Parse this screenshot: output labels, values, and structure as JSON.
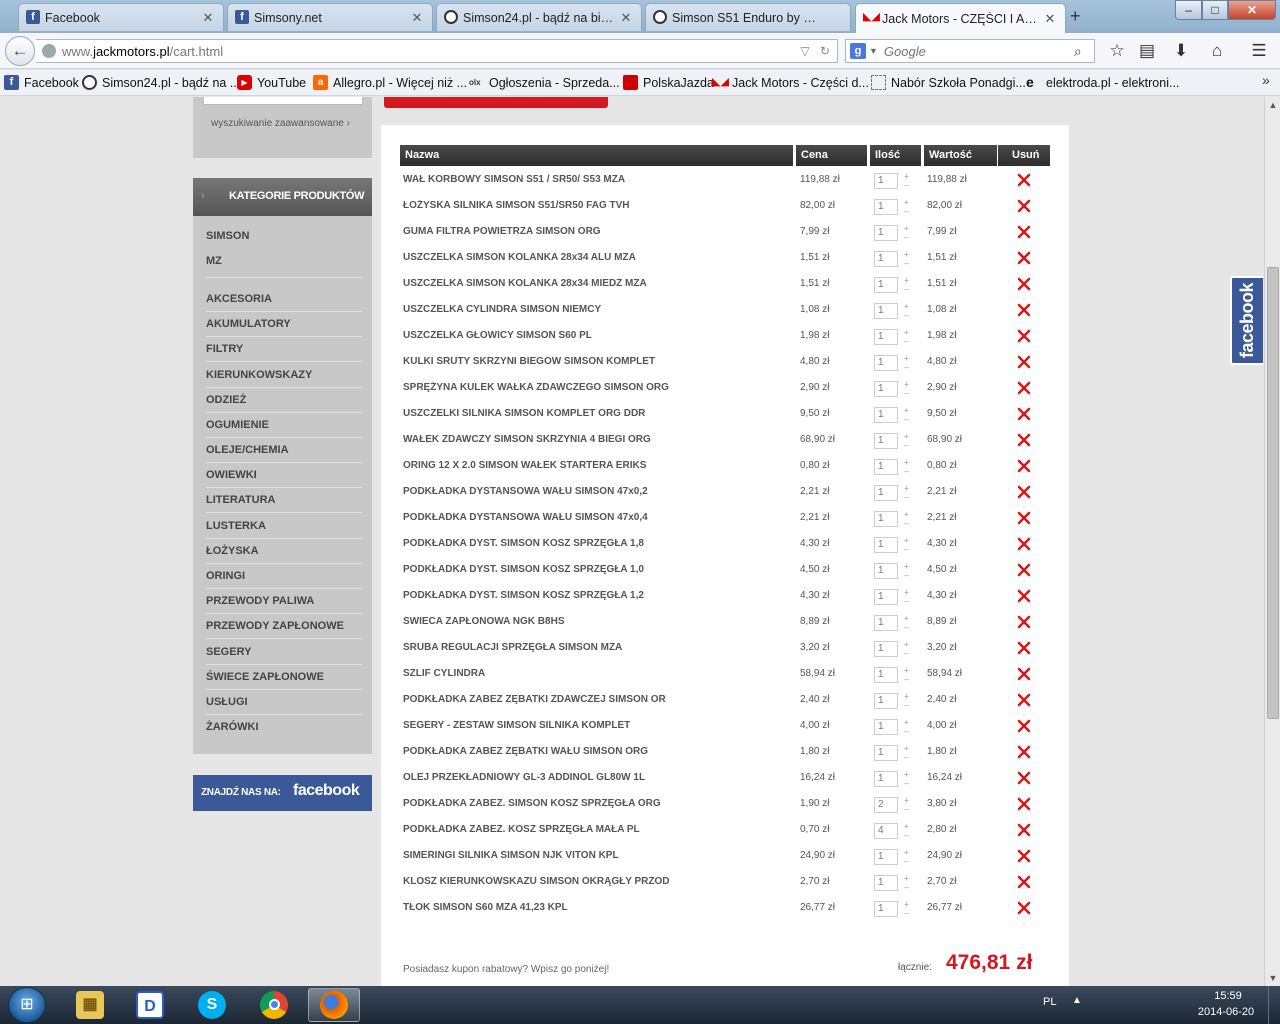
{
  "tabs": [
    {
      "label": "Facebook",
      "icon": "facebook-icon",
      "close": "✕"
    },
    {
      "label": "Simsony.net",
      "icon": "facebook-icon",
      "close": "✕"
    },
    {
      "label": "Simson24.pl - bądź na bież...",
      "icon": "clock-icon",
      "close": "✕"
    },
    {
      "label": "Simson S51 Enduro by Dan...",
      "icon": "clock-icon",
      "close": ""
    },
    {
      "label": "Jack Motors - CZĘŚCI I AK...",
      "icon": "motorbike-icon",
      "close": "✕"
    }
  ],
  "newtab_label": "+",
  "window": {
    "minimize": "–",
    "maximize": "□",
    "close": "✕"
  },
  "address": {
    "prefix": "www.",
    "domain": "jackmotors.pl",
    "path": "/cart.html"
  },
  "search": {
    "placeholder": "Google",
    "engine_icon": "google-icon"
  },
  "bookmarks": [
    {
      "label": "Facebook",
      "icon": "facebook-icon"
    },
    {
      "label": "Simson24.pl - bądź na ...",
      "icon": "clock-icon"
    },
    {
      "label": "YouTube",
      "icon": "youtube-icon"
    },
    {
      "label": "Allegro.pl - Więcej niż ...",
      "icon": "allegro-icon"
    },
    {
      "label": "Ogłoszenia - Sprzeda...",
      "icon": "olx-icon"
    },
    {
      "label": "PolskaJazda",
      "icon": "polskajazda-icon"
    },
    {
      "label": "Jack Motors - Części d...",
      "icon": "motorbike-icon"
    },
    {
      "label": "Nabór Szkoła Ponadgi...",
      "icon": "page-icon"
    },
    {
      "label": "elektroda.pl - elektroni...",
      "icon": "elektroda-icon"
    }
  ],
  "bookmarks_more": "»",
  "sidebar": {
    "adv_search": "wyszukiwanie zaawansowane ›",
    "cat_title": "KATEGORIE PRODUKTÓW",
    "categories": [
      "SIMSON",
      "MZ",
      "AKCESORIA",
      "AKUMULATORY",
      "FILTRY",
      "KIERUNKOWSKAZY",
      "ODZIEŻ",
      "OGUMIENIE",
      "OLEJE/CHEMIA",
      "OWIEWKI",
      "LITERATURA",
      "LUSTERKA",
      "ŁOŻYSKA",
      "ORINGI",
      "PRZEWODY PALIWA",
      "PRZEWODY ZAPŁONOWE",
      "SEGERY",
      "ŚWIECE ZAPŁONOWE",
      "USŁUGI",
      "ŻARÓWKI"
    ],
    "fb_find": "ZNAJDŹ NAS NA:",
    "fb_logo": "facebook"
  },
  "cart": {
    "headers": {
      "name": "Nazwa",
      "price": "Cena",
      "qty": "Ilość",
      "value": "Wartość",
      "remove": "Usuń"
    },
    "spinner": {
      "up": "+",
      "down": "–"
    },
    "items": [
      {
        "name": "WAŁ KORBOWY SIMSON S51 / SR50/ S53 MZA",
        "price": "119,88 zł",
        "qty": "1",
        "value": "119,88 zł"
      },
      {
        "name": "ŁOŻYSKA SILNIKA SIMSON S51/SR50 FAG TVH",
        "price": "82,00 zł",
        "qty": "1",
        "value": "82,00 zł"
      },
      {
        "name": "GUMA FILTRA POWIETRZA SIMSON ORG",
        "price": "7,99 zł",
        "qty": "1",
        "value": "7,99 zł"
      },
      {
        "name": "USZCZELKA SIMSON KOLANKA 28x34 ALU MZA",
        "price": "1,51 zł",
        "qty": "1",
        "value": "1,51 zł"
      },
      {
        "name": "USZCZELKA SIMSON KOLANKA 28x34 MIEDŹ MZA",
        "price": "1,51 zł",
        "qty": "1",
        "value": "1,51 zł"
      },
      {
        "name": "USZCZELKA CYLINDRA SIMSON NIEMCY",
        "price": "1,08 zł",
        "qty": "1",
        "value": "1,08 zł"
      },
      {
        "name": "USZCZELKA GŁOWICY SIMSON S60 PL",
        "price": "1,98 zł",
        "qty": "1",
        "value": "1,98 zł"
      },
      {
        "name": "KULKI ŚRUTY SKRZYNI BIEGÓW SIMSON KOMPLET",
        "price": "4,80 zł",
        "qty": "1",
        "value": "4,80 zł"
      },
      {
        "name": "SPRĘŻYNA KULEK WAŁKA ZDAWCZEGO SIMSON ORG",
        "price": "2,90 zł",
        "qty": "1",
        "value": "2,90 zł"
      },
      {
        "name": "USZCZELKI SILNIKA SIMSON KOMPLET ORG DDR",
        "price": "9,50 zł",
        "qty": "1",
        "value": "9,50 zł"
      },
      {
        "name": "WAŁEK ZDAWCZY SIMSON SKRZYNIA 4 BIEGI ORG",
        "price": "68,90 zł",
        "qty": "1",
        "value": "68,90 zł"
      },
      {
        "name": "ORING 12 X 2.0 SIMSON WAŁEK STARTERA ERIKS",
        "price": "0,80 zł",
        "qty": "1",
        "value": "0,80 zł"
      },
      {
        "name": "PODKŁADKA DYSTANSOWA WAŁU SIMSON 47x0,2",
        "price": "2,21 zł",
        "qty": "1",
        "value": "2,21 zł"
      },
      {
        "name": "PODKŁADKA DYSTANSOWA WAŁU SIMSON 47x0,4",
        "price": "2,21 zł",
        "qty": "1",
        "value": "2,21 zł"
      },
      {
        "name": "PODKŁADKA DYST. SIMSON KOSZ SPRZĘGŁA 1,8",
        "price": "4,30 zł",
        "qty": "1",
        "value": "4,30 zł"
      },
      {
        "name": "PODKŁADKA DYST. SIMSON KOSZ SPRZĘGŁA 1,0",
        "price": "4,50 zł",
        "qty": "1",
        "value": "4,50 zł"
      },
      {
        "name": "PODKŁADKA DYST. SIMSON KOSZ SPRZĘGŁA 1,2",
        "price": "4,30 zł",
        "qty": "1",
        "value": "4,30 zł"
      },
      {
        "name": "ŚWIECA ZAPŁONOWA NGK B8HS",
        "price": "8,89 zł",
        "qty": "1",
        "value": "8,89 zł"
      },
      {
        "name": "ŚRUBA REGULACJI SPRZĘGŁA SIMSON MZA",
        "price": "3,20 zł",
        "qty": "1",
        "value": "3,20 zł"
      },
      {
        "name": "SZLIF CYLINDRA",
        "price": "58,94 zł",
        "qty": "1",
        "value": "58,94 zł"
      },
      {
        "name": "PODKŁADKA ZABEZ ZĘBATKI ZDAWCZEJ SIMSON OR",
        "price": "2,40 zł",
        "qty": "1",
        "value": "2,40 zł"
      },
      {
        "name": "SEGERY - ZESTAW SIMSON SILNIKA KOMPLET",
        "price": "4,00 zł",
        "qty": "1",
        "value": "4,00 zł"
      },
      {
        "name": "PODKŁADKA ZABEZ ZĘBATKI WAŁU SIMSON ORG",
        "price": "1,80 zł",
        "qty": "1",
        "value": "1,80 zł"
      },
      {
        "name": "OLEJ PRZEKŁADNIOWY GL-3 ADDINOL GL80W 1L",
        "price": "16,24 zł",
        "qty": "1",
        "value": "16,24 zł"
      },
      {
        "name": "PODKŁADKA ZABEZ. SIMSON KOSZ SPRZĘGŁA ORG",
        "price": "1,90 zł",
        "qty": "2",
        "value": "3,80 zł"
      },
      {
        "name": "PODKŁADKA ZABEZ. KOSZ SPRZĘGŁA MAŁA PL",
        "price": "0,70 zł",
        "qty": "4",
        "value": "2,80 zł"
      },
      {
        "name": "SIMERINGI SILNIKA SIMSON NJK VITON KPL",
        "price": "24,90 zł",
        "qty": "1",
        "value": "24,90 zł"
      },
      {
        "name": "KLOSZ KIERUNKOWSKAZU SIMSON OKRĄGŁY PRZÓD",
        "price": "2,70 zł",
        "qty": "1",
        "value": "2,70 zł"
      },
      {
        "name": "TŁOK SIMSON S60 MZA 41,23 KPL",
        "price": "26,77 zł",
        "qty": "1",
        "value": "26,77 zł"
      }
    ],
    "coupon_text": "Posiadasz kupon rabatowy? Wpisz go poniżej!",
    "total_label": "łącznie:",
    "total_value": "476,81 zł"
  },
  "fb_side": "facebook",
  "taskbar": {
    "apps": [
      {
        "name": "file-explorer-icon"
      },
      {
        "name": "d-app-icon"
      },
      {
        "name": "skype-icon"
      },
      {
        "name": "chrome-icon"
      },
      {
        "name": "firefox-icon"
      }
    ],
    "lang": "PL",
    "tray_arrow": "▲",
    "time": "15:59",
    "date": "2014-06-20"
  },
  "colors": {
    "accent_red": "#d3191f",
    "facebook_blue": "#3b5998",
    "table_header": "#333333"
  }
}
